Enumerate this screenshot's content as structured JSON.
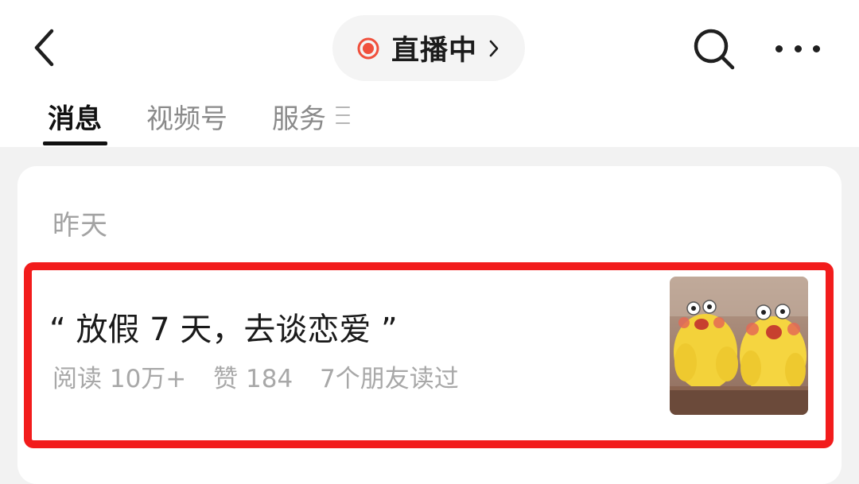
{
  "header": {
    "live_label": "直播中",
    "icons": {
      "back": "chevron-left-icon",
      "live_dot": "live-record-icon",
      "live_chevron": "chevron-right-icon",
      "search": "search-icon",
      "more": "more-horizontal-icon"
    },
    "colors": {
      "live_dot": "#f0503c",
      "text_primary": "#111111",
      "text_secondary": "#8a8a8a"
    }
  },
  "tabs": [
    {
      "label": "消息",
      "active": true
    },
    {
      "label": "视频号",
      "active": false
    },
    {
      "label": "服务",
      "active": false
    }
  ],
  "feed": {
    "date_label": "昨天",
    "article": {
      "title": "“ 放假 7 天，去谈恋爱 ”",
      "meta": {
        "reads": "阅读 10万+",
        "likes": "赞 184",
        "friends": "7个朋友读过"
      },
      "thumbnail": "two-yellow-chick-toys-image"
    },
    "highlight_color": "#f21c1c"
  }
}
